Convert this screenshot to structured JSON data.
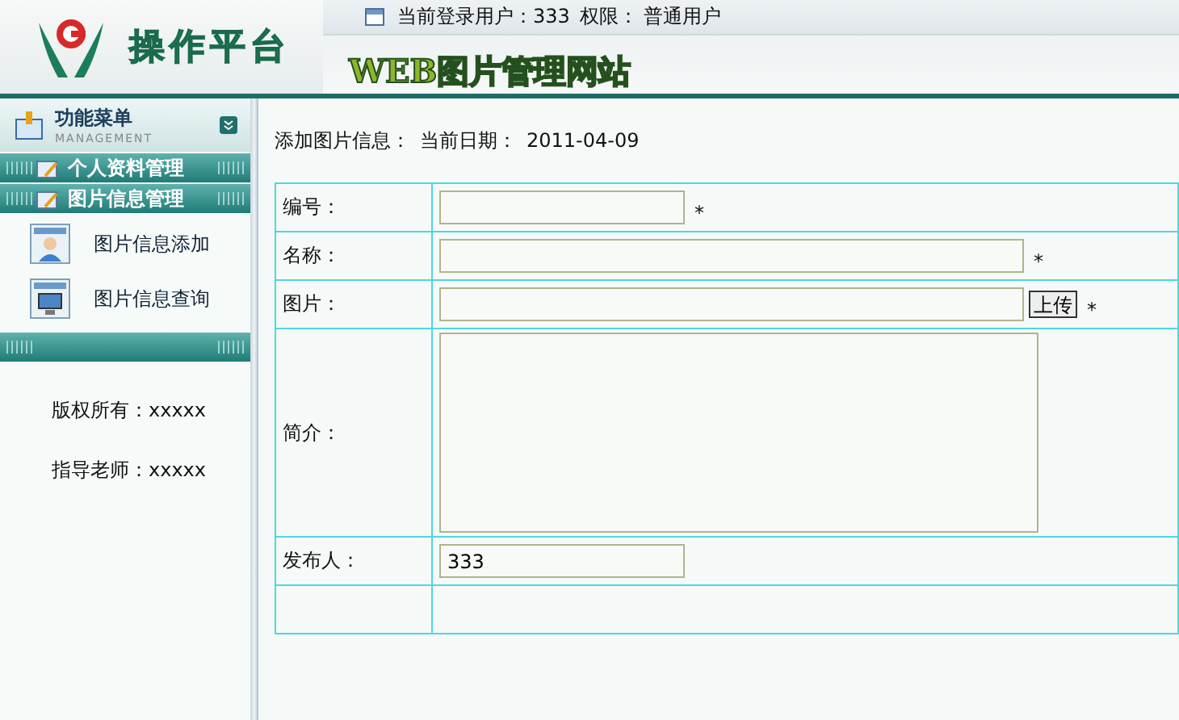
{
  "header": {
    "logo_text": "操作平台",
    "site_title": "WEB图片管理网站",
    "user_label": "当前登录用户：",
    "user": "333",
    "role_label": "权限：",
    "role": "普通用户"
  },
  "sidebar": {
    "title": "功能菜单",
    "subtitle": "MANAGEMENT",
    "menu": [
      {
        "kind": "group",
        "label": "个人资料管理"
      },
      {
        "kind": "group",
        "label": "图片信息管理"
      },
      {
        "kind": "item",
        "label": "图片信息添加"
      },
      {
        "kind": "item",
        "label": "图片信息查询"
      },
      {
        "kind": "bar"
      }
    ],
    "footer": [
      "版权所有：xxxxx",
      "指导老师：xxxxx"
    ]
  },
  "form": {
    "title": "添加图片信息：",
    "date_label": "当前日期：",
    "date": "2011-04-09",
    "fields": [
      {
        "label": "编号：",
        "kind": "short",
        "required_mark": "*"
      },
      {
        "label": "名称：",
        "kind": "long",
        "required_mark": "*"
      },
      {
        "label": "图片：",
        "kind": "file",
        "button": "上传",
        "required_mark": "*"
      },
      {
        "label": "简介：",
        "kind": "textarea"
      },
      {
        "label": "发布人：",
        "kind": "short",
        "value": "333"
      },
      {
        "kind": "empty"
      }
    ]
  }
}
